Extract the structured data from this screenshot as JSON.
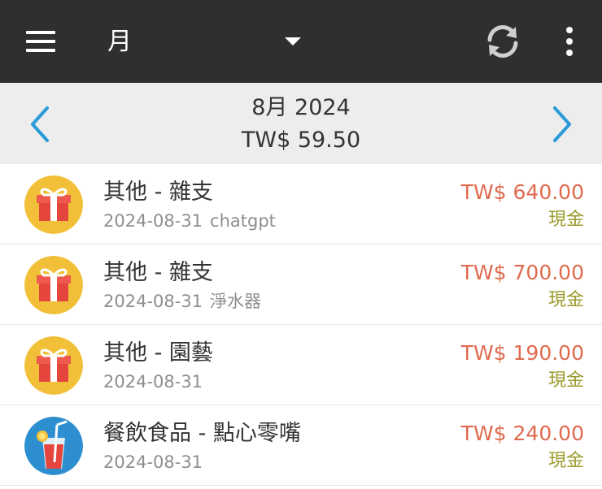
{
  "appbar": {
    "period_label": "月"
  },
  "period": {
    "title": "8月  2024",
    "total": "TW$ 59.50"
  },
  "entries": [
    {
      "category": "其他 - 雜支",
      "date": "2024-08-31",
      "note": "chatgpt",
      "amount": "TW$ 640.00",
      "account": "現金",
      "icon": "gift-icon"
    },
    {
      "category": "其他 - 雜支",
      "date": "2024-08-31",
      "note": "淨水器",
      "amount": "TW$ 700.00",
      "account": "現金",
      "icon": "gift-icon"
    },
    {
      "category": "其他 - 園藝",
      "date": "2024-08-31",
      "note": "",
      "amount": "TW$ 190.00",
      "account": "現金",
      "icon": "gift-icon"
    },
    {
      "category": "餐飲食品 - 點心零嘴",
      "date": "2024-08-31",
      "note": "",
      "amount": "TW$ 240.00",
      "account": "現金",
      "icon": "drink-icon"
    }
  ],
  "colors": {
    "appbar": "#2f2f2f",
    "accent": "#2a9ad8",
    "expense": "#e06a4e",
    "account": "#9a9a2b",
    "gift_bg": "#f2c038",
    "drink_bg": "#2d8fd0"
  }
}
